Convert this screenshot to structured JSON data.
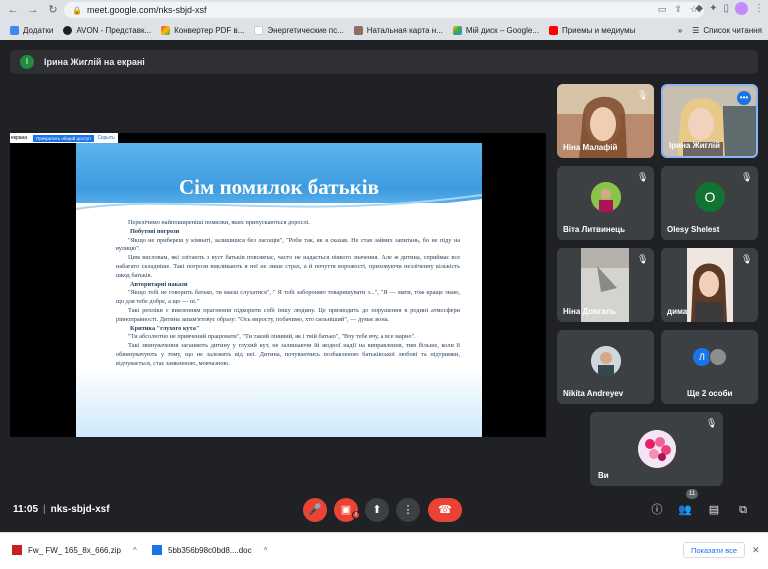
{
  "browser": {
    "url": "meet.google.com/nks-sbjd-xsf",
    "bookmarks": [
      {
        "label": "Додатки",
        "color": "#4285f4"
      },
      {
        "label": "AVON - Представк...",
        "color": "#202124"
      },
      {
        "label": "Конвертер PDF в...",
        "color": "#ea4335"
      },
      {
        "label": "Энергетические пс...",
        "color": "#ffffff"
      },
      {
        "label": "Натальная карта н...",
        "color": "#8d6e63"
      },
      {
        "label": "Мій диск – Google...",
        "color": "#34a853"
      },
      {
        "label": "Приемы и медиумы",
        "color": "#ff0000"
      }
    ],
    "reading_list": "Список читання"
  },
  "meet": {
    "presenting_label": "Ірина Жиглій на екрані",
    "presenter_initial": "I",
    "stage": {
      "strip_label_left": "екрана",
      "strip_button": "Прекратить общий доступ",
      "strip_label_right": "Скрыть",
      "slide_title": "Сім помилок батьків",
      "lines": [
        {
          "kind": "p",
          "text": "Перелічимо найпоширеніші помилки, яких припускаються дорослі."
        },
        {
          "kind": "h",
          "text": "Побутові погрози"
        },
        {
          "kind": "p",
          "text": "\"Якщо не прибереш у кімнаті, залишишся без ласощів\", \"Роби так, як я сказав. Не став зайвих запитань, бо не піду на вулицю\"."
        },
        {
          "kind": "p",
          "text": "Цим висловам, які злітають з вуст батьків повсякчас, часто не надається ніякого значення. Але ж дитина, сприймає все набагато складніше. Такі погрози викликають в неї не лише страх, а й почуття ворожості, приховуючи незліченну кількість шкод батьків."
        },
        {
          "kind": "h",
          "text": "Авторитарні накази"
        },
        {
          "kind": "p",
          "text": "\"Якщо тобі не говорить батько, ти маєш слухатися\", \" Я тобі забороняю товаришувати з...\", \"Я — мати, тож краще знаю, що для тебе добре, а що — ні.\""
        },
        {
          "kind": "p",
          "text": "Такі репліки є вияленням прагнення підкорити собі іншу людину. Це призводить до порушення в родині атмосфери рівноправності. Дитина запам'ятовує образу: \"Ось виросту, побачимо, хто сильніший\", — думає вона."
        },
        {
          "kind": "h",
          "text": "Критика \"глухого кута\""
        },
        {
          "kind": "p",
          "text": "\"Ти абсолютно не привчений працювати\", \"Ти такий лінивий, як і твій батько\", \"Вчу тебе вчу, а все марно\"."
        },
        {
          "kind": "p",
          "text": "Такі звинувачення заганяють дитину у глухий кут, не залишаючи їй жодної надії на виправлення, тим більше, коли її обвинувачують у тому, що не залежить від неї. Дитина, почуваючись позбавленою батьківської любові та підтримки, відчувається, стає замкненою, мовчазною."
        }
      ]
    },
    "participants": [
      {
        "name": "Ніна Малафій",
        "type": "photo",
        "muted": true
      },
      {
        "name": "Ірина Жиглій",
        "type": "photo",
        "muted": false,
        "more": "•••"
      },
      {
        "name": "Віта Литвинець",
        "type": "avatar",
        "initial": "",
        "color": "#7cb342",
        "muted": true
      },
      {
        "name": "Olesy Shelest",
        "type": "avatar",
        "initial": "O",
        "color": "#137333",
        "muted": true
      },
      {
        "name": "Ніна Довгаль",
        "type": "photo",
        "muted": true
      },
      {
        "name": "дима",
        "type": "photo",
        "muted": true
      },
      {
        "name": "Nikita Andreyev",
        "type": "avatar",
        "initial": "",
        "color": "#9e9e9e",
        "muted": true
      },
      {
        "name": "Ще 2 особи",
        "type": "group",
        "initial": "Л",
        "color": "#1a73e8",
        "muted": false
      },
      {
        "name": "Ви",
        "type": "avatar",
        "initial": "",
        "color": "#f8bbd0",
        "muted": true
      }
    ],
    "controls": {
      "time": "11:05",
      "meeting_code": "nks-sbjd-xsf",
      "participant_count": "11",
      "camera_error": "!"
    }
  },
  "downloads": [
    {
      "name": "Fw_ FW_ 165_8x_666.zip",
      "color": "#c5221f"
    },
    {
      "name": "5bb356b98c0bd8....doc",
      "color": "#1a73e8"
    }
  ],
  "downloads_show_all": "Показати все"
}
